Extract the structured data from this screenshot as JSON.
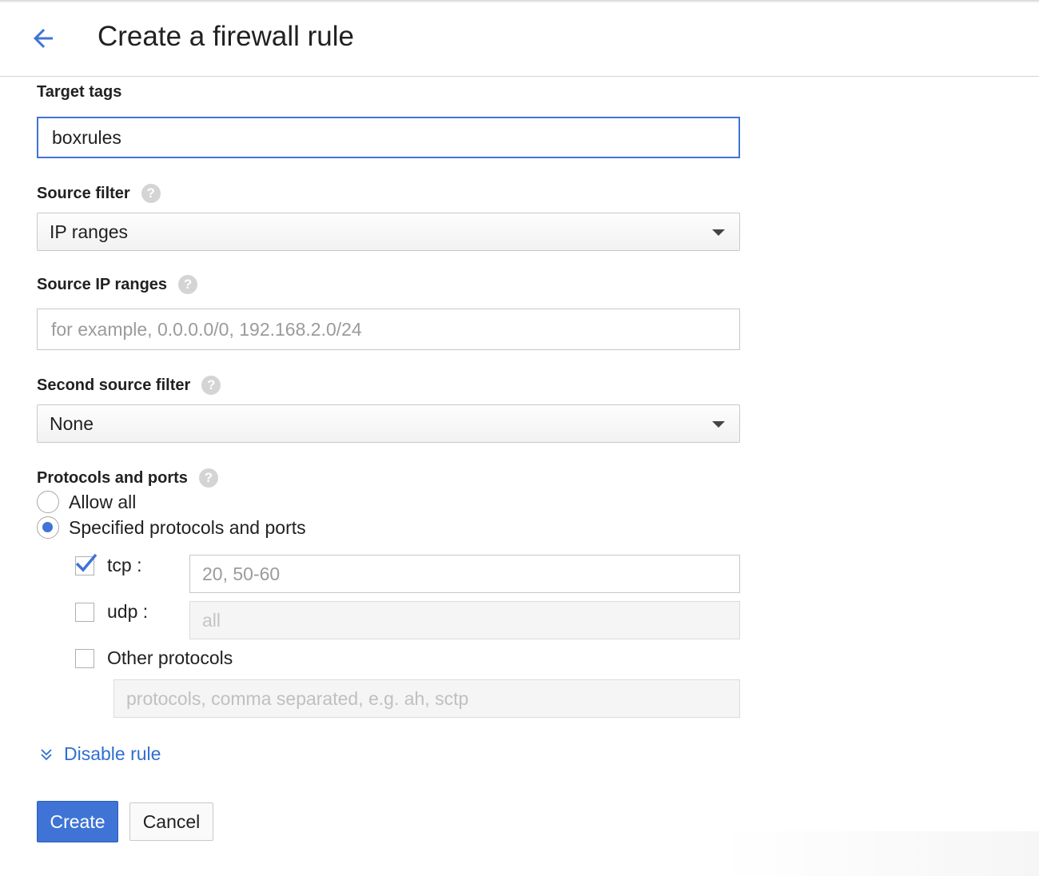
{
  "header": {
    "title": "Create a firewall rule",
    "back_icon": "arrow-left-icon"
  },
  "accent_color": "#3f74d6",
  "link_color": "#2f6fd0",
  "target_tags": {
    "label": "Target tags",
    "value": "boxrules"
  },
  "source_filter": {
    "label": "Source filter",
    "help_glyph": "?",
    "selected": "IP ranges"
  },
  "source_ip_ranges": {
    "label": "Source IP ranges",
    "help_glyph": "?",
    "placeholder": "for example, 0.0.0.0/0, 192.168.2.0/24"
  },
  "second_source_filter": {
    "label": "Second source filter",
    "help_glyph": "?",
    "selected": "None"
  },
  "protocols": {
    "label": "Protocols and ports",
    "help_glyph": "?",
    "options": [
      {
        "label": "Allow all",
        "checked": false
      },
      {
        "label": "Specified protocols and ports",
        "checked": true
      }
    ],
    "tcp": {
      "label": "tcp :",
      "checked": true,
      "placeholder": "20, 50-60"
    },
    "udp": {
      "label": "udp :",
      "checked": false,
      "placeholder": "all"
    },
    "other": {
      "label": "Other protocols",
      "checked": false,
      "placeholder": "protocols, comma separated, e.g. ah, sctp"
    }
  },
  "disable_rule": {
    "label": "Disable rule",
    "icon": "chevron-double-down-icon"
  },
  "actions": {
    "create": "Create",
    "cancel": "Cancel"
  }
}
